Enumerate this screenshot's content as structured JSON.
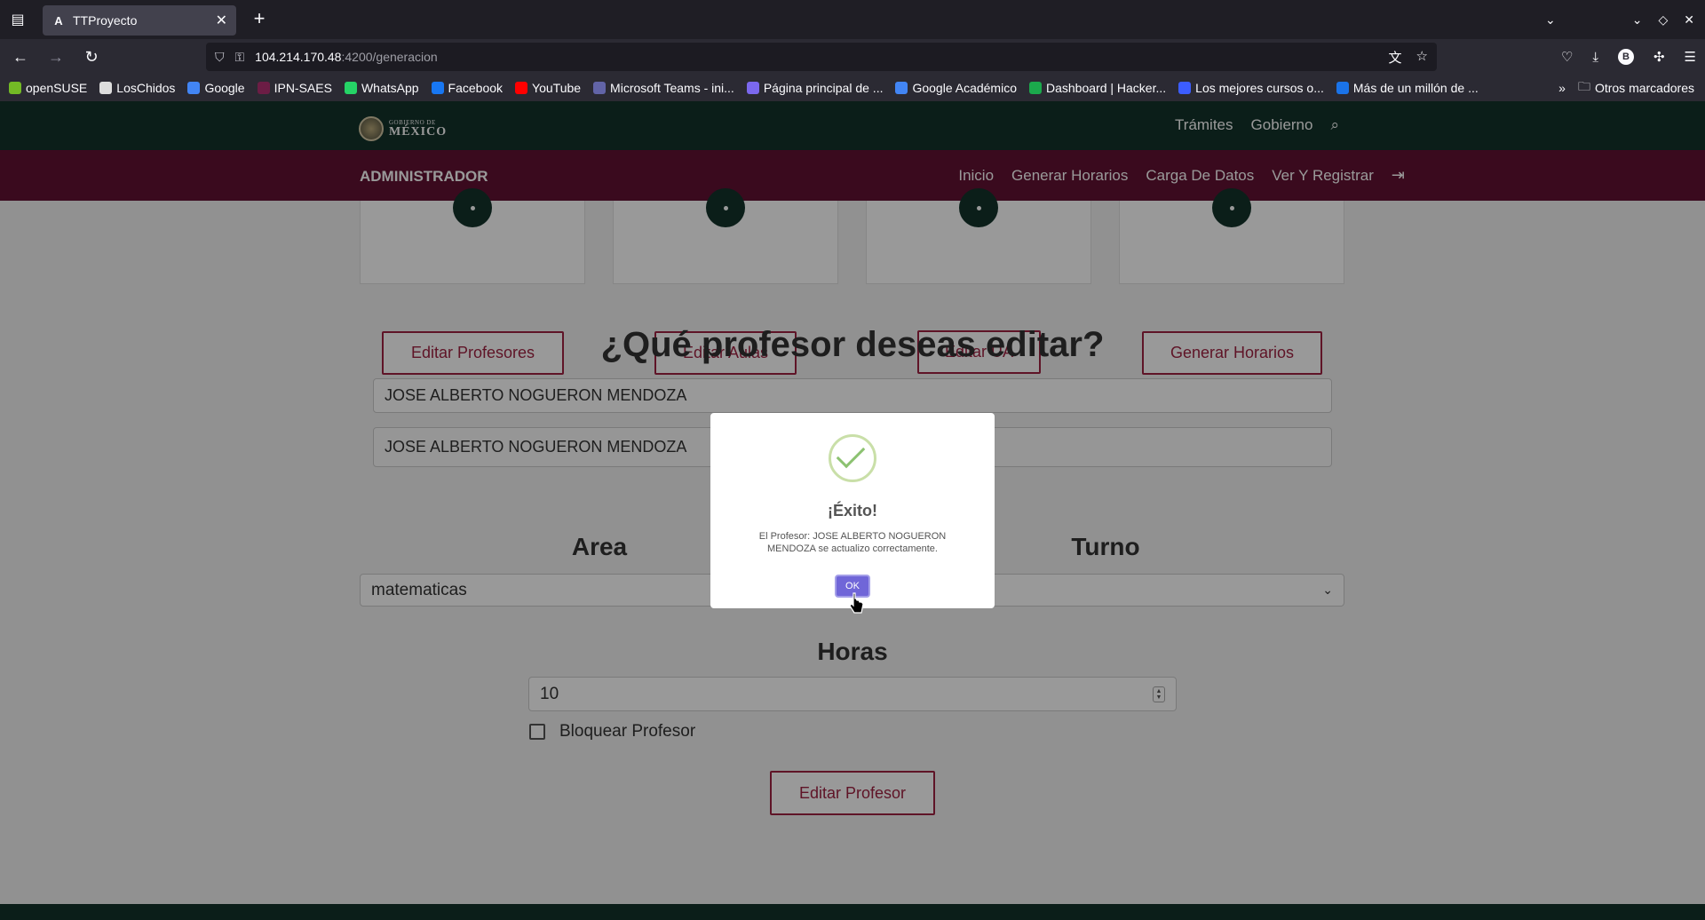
{
  "browser": {
    "tab_title": "TTProyecto",
    "tab_favicon": "A",
    "url_host": "104.214.170.48",
    "url_path": ":4200/generacion",
    "bookmarks": [
      {
        "label": "openSUSE",
        "icon": "opensuse-icon",
        "color": "#73ba25"
      },
      {
        "label": "LosChidos",
        "icon": "github-icon",
        "color": "#dddddd"
      },
      {
        "label": "Google",
        "icon": "google-icon",
        "color": "#4285f4"
      },
      {
        "label": "IPN-SAES",
        "icon": "ipn-icon",
        "color": "#6c1d45"
      },
      {
        "label": "WhatsApp",
        "icon": "whatsapp-icon",
        "color": "#25d366"
      },
      {
        "label": "Facebook",
        "icon": "facebook-icon",
        "color": "#1877f2"
      },
      {
        "label": "YouTube",
        "icon": "youtube-icon",
        "color": "#ff0000"
      },
      {
        "label": "Microsoft Teams - ini...",
        "icon": "teams-icon",
        "color": "#6264a7"
      },
      {
        "label": "Página principal de ...",
        "icon": "page-icon",
        "color": "#7b68ee"
      },
      {
        "label": "Google Académico",
        "icon": "scholar-icon",
        "color": "#4285f4"
      },
      {
        "label": "Dashboard | Hacker...",
        "icon": "hackerrank-icon",
        "color": "#1ba94c"
      },
      {
        "label": "Los mejores cursos o...",
        "icon": "courses-icon",
        "color": "#3c5dff"
      },
      {
        "label": "Más de un millón de ...",
        "icon": "million-icon",
        "color": "#1a73e8"
      }
    ],
    "other_bookmarks": "Otros marcadores",
    "account_initial": "B"
  },
  "gov_header": {
    "logo_small": "GOBIERNO DE",
    "logo_big": "MÉXICO",
    "nav": [
      "Trámites",
      "Gobierno"
    ]
  },
  "admin_bar": {
    "title": "ADMINISTRADOR",
    "nav": [
      "Inicio",
      "Generar Horarios",
      "Carga De Datos",
      "Ver Y Registrar"
    ]
  },
  "cards": [
    {
      "button": "Editar Profesores"
    },
    {
      "button": "Editar Aulas"
    },
    {
      "button": "Editar UA"
    },
    {
      "button": "Generar Horarios"
    }
  ],
  "form": {
    "heading": "¿Qué profesor deseas editar?",
    "search_value": "JOSE ALBERTO NOGUERON MENDOZA",
    "selected_value": "JOSE ALBERTO NOGUERON MENDOZA",
    "area_label": "Area",
    "area_value": "matematicas",
    "turno_label": "Turno",
    "horas_label": "Horas",
    "horas_value": "10",
    "block_label": "Bloquear Profesor",
    "submit": "Editar Profesor"
  },
  "modal": {
    "title": "¡Éxito!",
    "message": "El Profesor: JOSE ALBERTO NOGUERON MENDOZA se actualizo correctamente.",
    "ok": "OK"
  }
}
